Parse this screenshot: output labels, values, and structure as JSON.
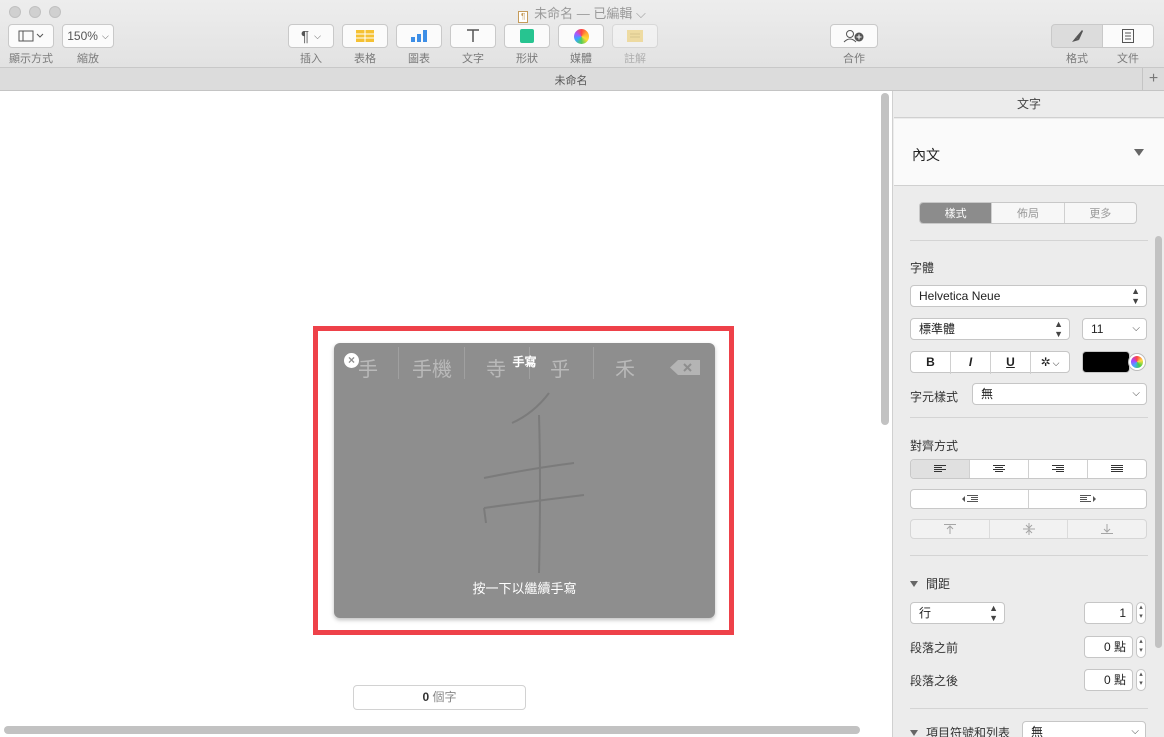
{
  "window": {
    "title": "未命名",
    "edit_status": "— 已編輯 ⌵"
  },
  "toolbar": {
    "view_label": "顯示方式",
    "zoom_value": "150%",
    "zoom_label": "縮放",
    "insert_label": "插入",
    "table_label": "表格",
    "chart_label": "圖表",
    "text_label": "文字",
    "shape_label": "形狀",
    "media_label": "媒體",
    "comment_label": "註解",
    "collaborate_label": "合作",
    "format_label": "格式",
    "document_label": "文件"
  },
  "tab": {
    "title": "未命名",
    "add": "+"
  },
  "canvas": {
    "word_count_number": "0",
    "word_count_unit": " 個字"
  },
  "handwriting": {
    "title": "手寫",
    "candidates": [
      "手",
      "手機",
      "寺",
      "乎",
      "禾"
    ],
    "hint": "按一下以繼續手寫",
    "close": "×"
  },
  "inspector": {
    "header": "文字",
    "paragraph_style": "內文",
    "tabs": [
      "樣式",
      "佈局",
      "更多"
    ],
    "active_tab": "樣式",
    "font_section": "字體",
    "font_name": "Helvetica Neue",
    "font_style": "標準體",
    "font_size": "11",
    "bold": "B",
    "italic": "I",
    "underline": "U",
    "text_color": "#000000",
    "char_style_label": "字元樣式",
    "char_style_value": "無",
    "alignment_label": "對齊方式",
    "spacing_label": "間距",
    "line_spacing_type": "行",
    "line_spacing_value": "1",
    "before_label": "段落之前",
    "before_value": "0 點",
    "after_label": "段落之後",
    "after_value": "0 點",
    "bullets_label": "項目符號和列表",
    "bullets_value": "無"
  }
}
